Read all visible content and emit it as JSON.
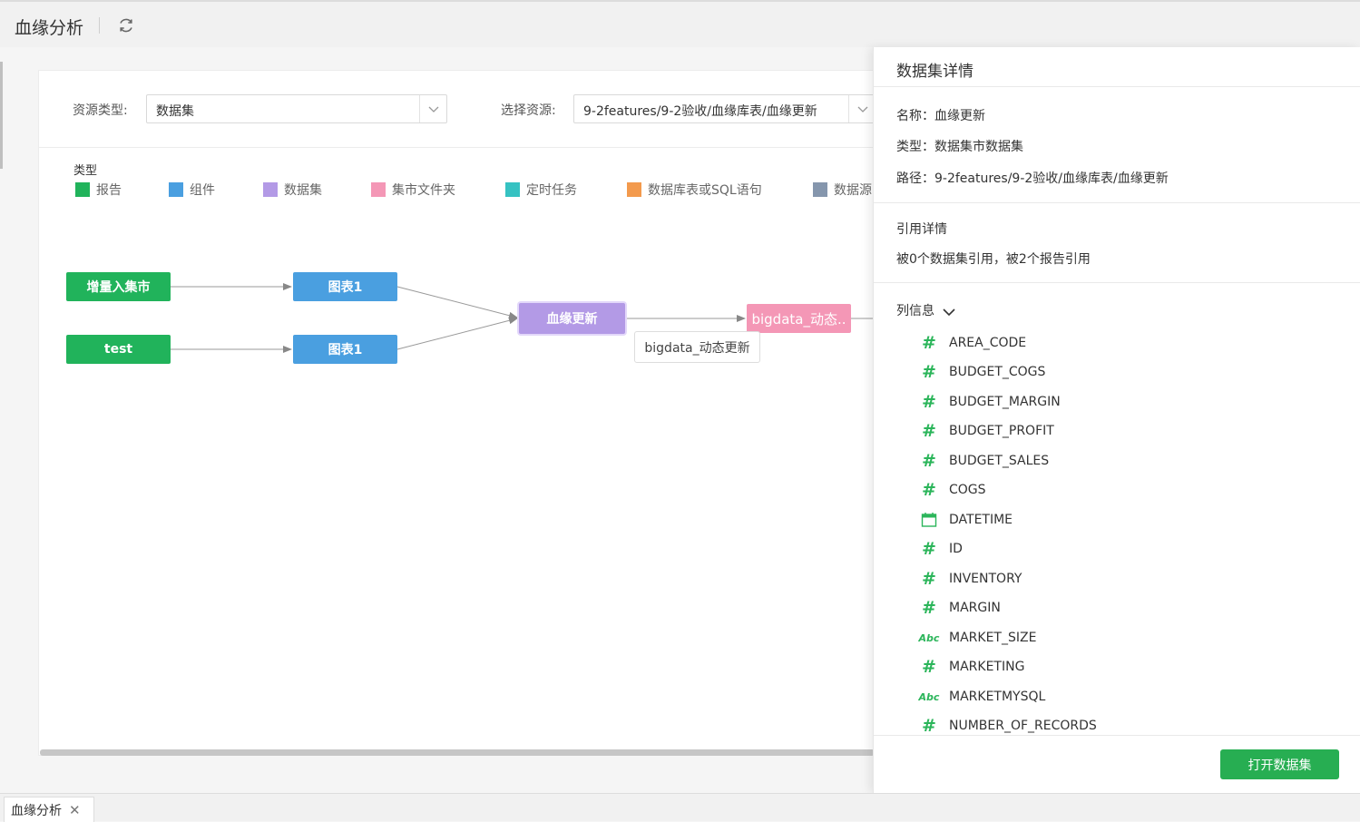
{
  "header": {
    "title": "血缘分析"
  },
  "filters": {
    "resource_type_label": "资源类型:",
    "resource_type_value": "数据集",
    "resource_label": "选择资源:",
    "resource_value": "9-2features/9-2验收/血缘库表/血缘更新"
  },
  "legend": {
    "title": "类型",
    "items": [
      {
        "label": "报告",
        "color": "#21b35b"
      },
      {
        "label": "组件",
        "color": "#4a9fe0"
      },
      {
        "label": "数据集",
        "color": "#b39ae6"
      },
      {
        "label": "集市文件夹",
        "color": "#f497b6"
      },
      {
        "label": "定时任务",
        "color": "#36c2c2"
      },
      {
        "label": "数据库表或SQL语句",
        "color": "#f39a4d"
      },
      {
        "label": "数据源",
        "color": "#8596ad"
      }
    ]
  },
  "graph": {
    "nodes": [
      {
        "id": "n1",
        "label": "增量入集市",
        "type": "报告"
      },
      {
        "id": "n2",
        "label": "test",
        "type": "报告"
      },
      {
        "id": "n3",
        "label": "图表1",
        "type": "组件"
      },
      {
        "id": "n4",
        "label": "图表1",
        "type": "组件"
      },
      {
        "id": "n5",
        "label": "血缘更新",
        "type": "数据集"
      },
      {
        "id": "n6",
        "label": "bigdata_动态..",
        "type": "集市文件夹"
      }
    ],
    "tooltip": "bigdata_动态更新"
  },
  "detail": {
    "title": "数据集详情",
    "name": "名称：血缘更新",
    "type": "类型：数据集市数据集",
    "path": "路径：9-2features/9-2验收/血缘库表/血缘更新",
    "ref_title": "引用详情",
    "ref_text": "被0个数据集引用，被2个报告引用",
    "columns_title": "列信息",
    "columns": [
      {
        "name": "AREA_CODE",
        "icon": "number-icon"
      },
      {
        "name": "BUDGET_COGS",
        "icon": "number-icon"
      },
      {
        "name": "BUDGET_MARGIN",
        "icon": "number-icon"
      },
      {
        "name": "BUDGET_PROFIT",
        "icon": "number-icon"
      },
      {
        "name": "BUDGET_SALES",
        "icon": "number-icon"
      },
      {
        "name": "COGS",
        "icon": "number-icon"
      },
      {
        "name": "DATETIME",
        "icon": "calendar-icon"
      },
      {
        "name": "ID",
        "icon": "number-icon"
      },
      {
        "name": "INVENTORY",
        "icon": "number-icon"
      },
      {
        "name": "MARGIN",
        "icon": "number-icon"
      },
      {
        "name": "MARKET_SIZE",
        "icon": "text-icon"
      },
      {
        "name": "MARKETING",
        "icon": "number-icon"
      },
      {
        "name": "MARKETMYSQL",
        "icon": "text-icon"
      },
      {
        "name": "NUMBER_OF_RECORDS",
        "icon": "number-icon"
      }
    ],
    "open_button": "打开数据集"
  },
  "bottom_tabs": [
    {
      "label": "血缘分析"
    }
  ],
  "colors": {
    "accent": "#27ae52"
  }
}
